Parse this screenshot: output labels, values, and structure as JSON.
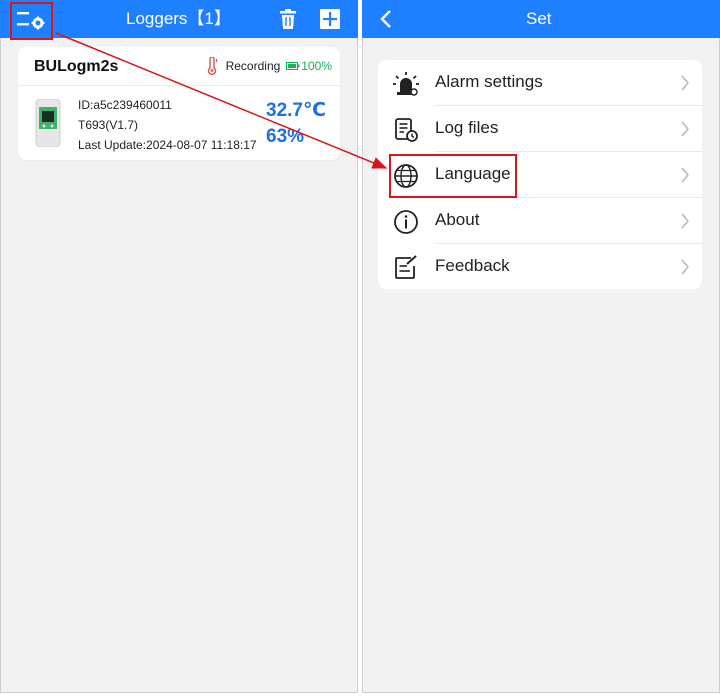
{
  "left": {
    "header": {
      "title": "Loggers【1】"
    },
    "card": {
      "device_name": "BULogm2s",
      "status_text": "Recording",
      "battery_text": "100%",
      "id_line": "ID:a5c239460011",
      "model_line": "T693(V1.7)",
      "last_update_line": "Last Update:2024-08-07 11:18:17",
      "temperature": "32.7℃",
      "humidity": "63%"
    }
  },
  "right": {
    "header": {
      "title": "Set"
    },
    "menu": [
      {
        "label": "Alarm settings",
        "icon": "alarm-light-icon"
      },
      {
        "label": "Log files",
        "icon": "log-file-icon"
      },
      {
        "label": "Language",
        "icon": "globe-icon"
      },
      {
        "label": "About",
        "icon": "info-icon"
      },
      {
        "label": "Feedback",
        "icon": "feedback-icon"
      }
    ]
  },
  "annotation_color": "#d8161b",
  "accent_color": "#1e80ff"
}
